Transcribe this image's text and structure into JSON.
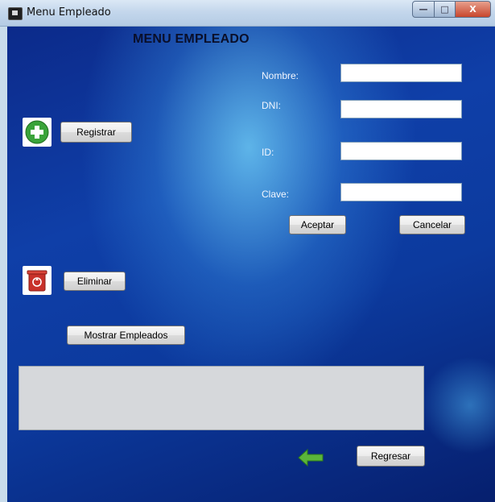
{
  "window": {
    "title": "Menu Empleado"
  },
  "titlebar_buttons": {
    "minimize": "—",
    "maximize": "□",
    "close": "X"
  },
  "heading": "MENU EMPLEADO",
  "form": {
    "nombre_label": "Nombre:",
    "dni_label": "DNI:",
    "id_label": "ID:",
    "clave_label": "Clave:",
    "nombre_value": "",
    "dni_value": "",
    "id_value": "",
    "clave_value": ""
  },
  "buttons": {
    "registrar": "Registrar",
    "aceptar": "Aceptar",
    "cancelar": "Cancelar",
    "eliminar": "Eliminar",
    "mostrar": "Mostrar Empleados",
    "regresar": "Regresar"
  },
  "icons": {
    "add": "plus-circle-icon",
    "delete": "trash-icon",
    "back": "arrow-left-icon"
  },
  "colors": {
    "background": "#0f3fa8",
    "add_icon": "#3aa33a",
    "delete_icon": "#c8312a",
    "back_icon": "#5bb53a",
    "list_area": "#d6d8db"
  }
}
